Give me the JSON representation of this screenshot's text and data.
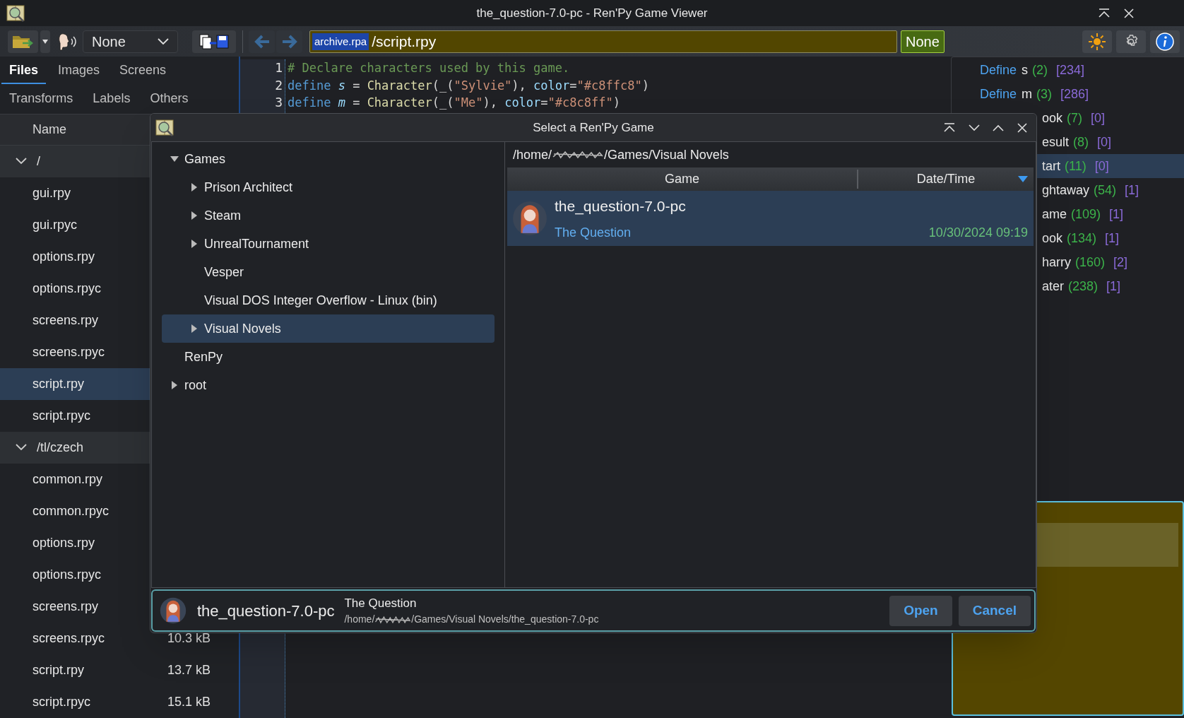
{
  "window": {
    "title": "the_question-7.0-pc - Ren'Py Game Viewer"
  },
  "toolbar": {
    "voice_dropdown": "None",
    "archive": "archive.rpa",
    "path": "/script.rpy",
    "filter_button": "None"
  },
  "tabs": [
    {
      "label": "Files",
      "selected": true
    },
    {
      "label": "Images",
      "selected": false
    },
    {
      "label": "Screens",
      "selected": false
    },
    {
      "label": "Transforms",
      "selected": false
    },
    {
      "label": "Labels",
      "selected": false
    },
    {
      "label": "Others",
      "selected": false
    }
  ],
  "file_list": {
    "column": "Name",
    "groups": [
      {
        "path": "/",
        "expanded": true,
        "files": [
          {
            "name": "gui.rpy",
            "selected": false
          },
          {
            "name": "gui.rpyc",
            "selected": false
          },
          {
            "name": "options.rpy",
            "selected": false
          },
          {
            "name": "options.rpyc",
            "selected": false
          },
          {
            "name": "screens.rpy",
            "selected": false
          },
          {
            "name": "screens.rpyc",
            "selected": false
          },
          {
            "name": "script.rpy",
            "selected": true
          },
          {
            "name": "script.rpyc",
            "selected": false
          }
        ]
      },
      {
        "path": "/tl/czech",
        "expanded": true,
        "files": [
          {
            "name": "common.rpy",
            "selected": false
          },
          {
            "name": "common.rpyc",
            "selected": false
          },
          {
            "name": "options.rpy",
            "selected": false
          },
          {
            "name": "options.rpyc",
            "selected": false
          },
          {
            "name": "screens.rpy",
            "selected": false
          },
          {
            "name": "screens.rpyc",
            "size": "10.3 kB",
            "selected": false
          },
          {
            "name": "script.rpy",
            "size": "13.7 kB",
            "selected": false
          },
          {
            "name": "script.rpyc",
            "size": "15.1 kB",
            "selected": false
          }
        ]
      }
    ]
  },
  "editor": {
    "lines": [
      {
        "number": "1",
        "tokens": [
          {
            "text": "# Declare characters used by this game.",
            "kind": "comment"
          }
        ]
      },
      {
        "number": "2",
        "tokens": [
          {
            "text": "define ",
            "kind": "keyword"
          },
          {
            "text": "s",
            "kind": "var"
          },
          {
            "text": " = ",
            "kind": "plain"
          },
          {
            "text": "Character",
            "kind": "func"
          },
          {
            "text": "(_(",
            "kind": "plain"
          },
          {
            "text": "\"Sylvie\"",
            "kind": "string"
          },
          {
            "text": "), ",
            "kind": "plain"
          },
          {
            "text": "color",
            "kind": "attr"
          },
          {
            "text": "=",
            "kind": "plain"
          },
          {
            "text": "\"#c8ffc8\"",
            "kind": "string"
          },
          {
            "text": ")",
            "kind": "plain"
          }
        ]
      },
      {
        "number": "3",
        "tokens": [
          {
            "text": "define ",
            "kind": "keyword"
          },
          {
            "text": "m",
            "kind": "var"
          },
          {
            "text": " = ",
            "kind": "plain"
          },
          {
            "text": "Character",
            "kind": "func"
          },
          {
            "text": "(_(",
            "kind": "plain"
          },
          {
            "text": "\"Me\"",
            "kind": "string"
          },
          {
            "text": "), ",
            "kind": "plain"
          },
          {
            "text": "color",
            "kind": "attr"
          },
          {
            "text": "=",
            "kind": "plain"
          },
          {
            "text": "\"#c8c8ff\"",
            "kind": "string"
          },
          {
            "text": ")",
            "kind": "plain"
          }
        ]
      }
    ]
  },
  "outline": [
    {
      "kind": "define",
      "keyword": "Define",
      "name": "s",
      "line": "(2)",
      "refs": "[234]",
      "selected": false
    },
    {
      "kind": "define",
      "keyword": "Define",
      "name": "m",
      "line": "(3)",
      "refs": "[286]",
      "selected": false
    },
    {
      "kind": "clipped",
      "name": "ook",
      "line": "(7)",
      "refs": "[0]",
      "selected": false
    },
    {
      "kind": "clipped",
      "name": "esult",
      "line": "(8)",
      "refs": "[0]",
      "selected": false
    },
    {
      "kind": "clipped",
      "name": "tart",
      "line": "(11)",
      "refs": "[0]",
      "selected": true
    },
    {
      "kind": "clipped",
      "name": "ghtaway",
      "line": "(54)",
      "refs": "[1]",
      "selected": false
    },
    {
      "kind": "clipped",
      "name": "ame",
      "line": "(109)",
      "refs": "[1]",
      "selected": false
    },
    {
      "kind": "clipped",
      "name": "ook",
      "line": "(134)",
      "refs": "[1]",
      "selected": false
    },
    {
      "kind": "clipped",
      "name": "harry",
      "line": "(160)",
      "refs": "[2]",
      "selected": false
    },
    {
      "kind": "clipped",
      "name": "ater",
      "line": "(238)",
      "refs": "[1]",
      "selected": false
    }
  ],
  "dialog": {
    "title": "Select a Ren'Py Game",
    "tree": [
      {
        "label": "Games",
        "expanded": true,
        "selected": false,
        "children": [
          {
            "label": "Prison Architect",
            "expanded": false,
            "selected": false
          },
          {
            "label": "Steam",
            "expanded": false,
            "selected": false
          },
          {
            "label": "UnrealTournament",
            "expanded": false,
            "selected": false
          },
          {
            "label": "Vesper",
            "selected": false
          },
          {
            "label": "Visual DOS Integer Overflow - Linux (bin)",
            "selected": false
          },
          {
            "label": "Visual Novels",
            "expanded": false,
            "selected": true
          }
        ]
      },
      {
        "label": "RenPy",
        "selected": false
      },
      {
        "label": "root",
        "expanded": false,
        "selected": false
      }
    ],
    "location": {
      "before": "/home/",
      "after": "/Games/Visual Novels"
    },
    "columns": [
      {
        "label": "Game",
        "sorted": false
      },
      {
        "label": "Date/Time",
        "sorted": true
      }
    ],
    "rows": [
      {
        "name": "the_question-7.0-pc",
        "title": "The Question",
        "date": "10/30/2024 09:19",
        "selected": true
      }
    ],
    "footer": {
      "name": "the_question-7.0-pc",
      "title": "The Question",
      "path_before": "/home/",
      "path_after": "/Games/Visual Novels/the_question-7.0-pc"
    },
    "buttons": [
      {
        "label": "Open"
      },
      {
        "label": "Cancel"
      }
    ]
  }
}
